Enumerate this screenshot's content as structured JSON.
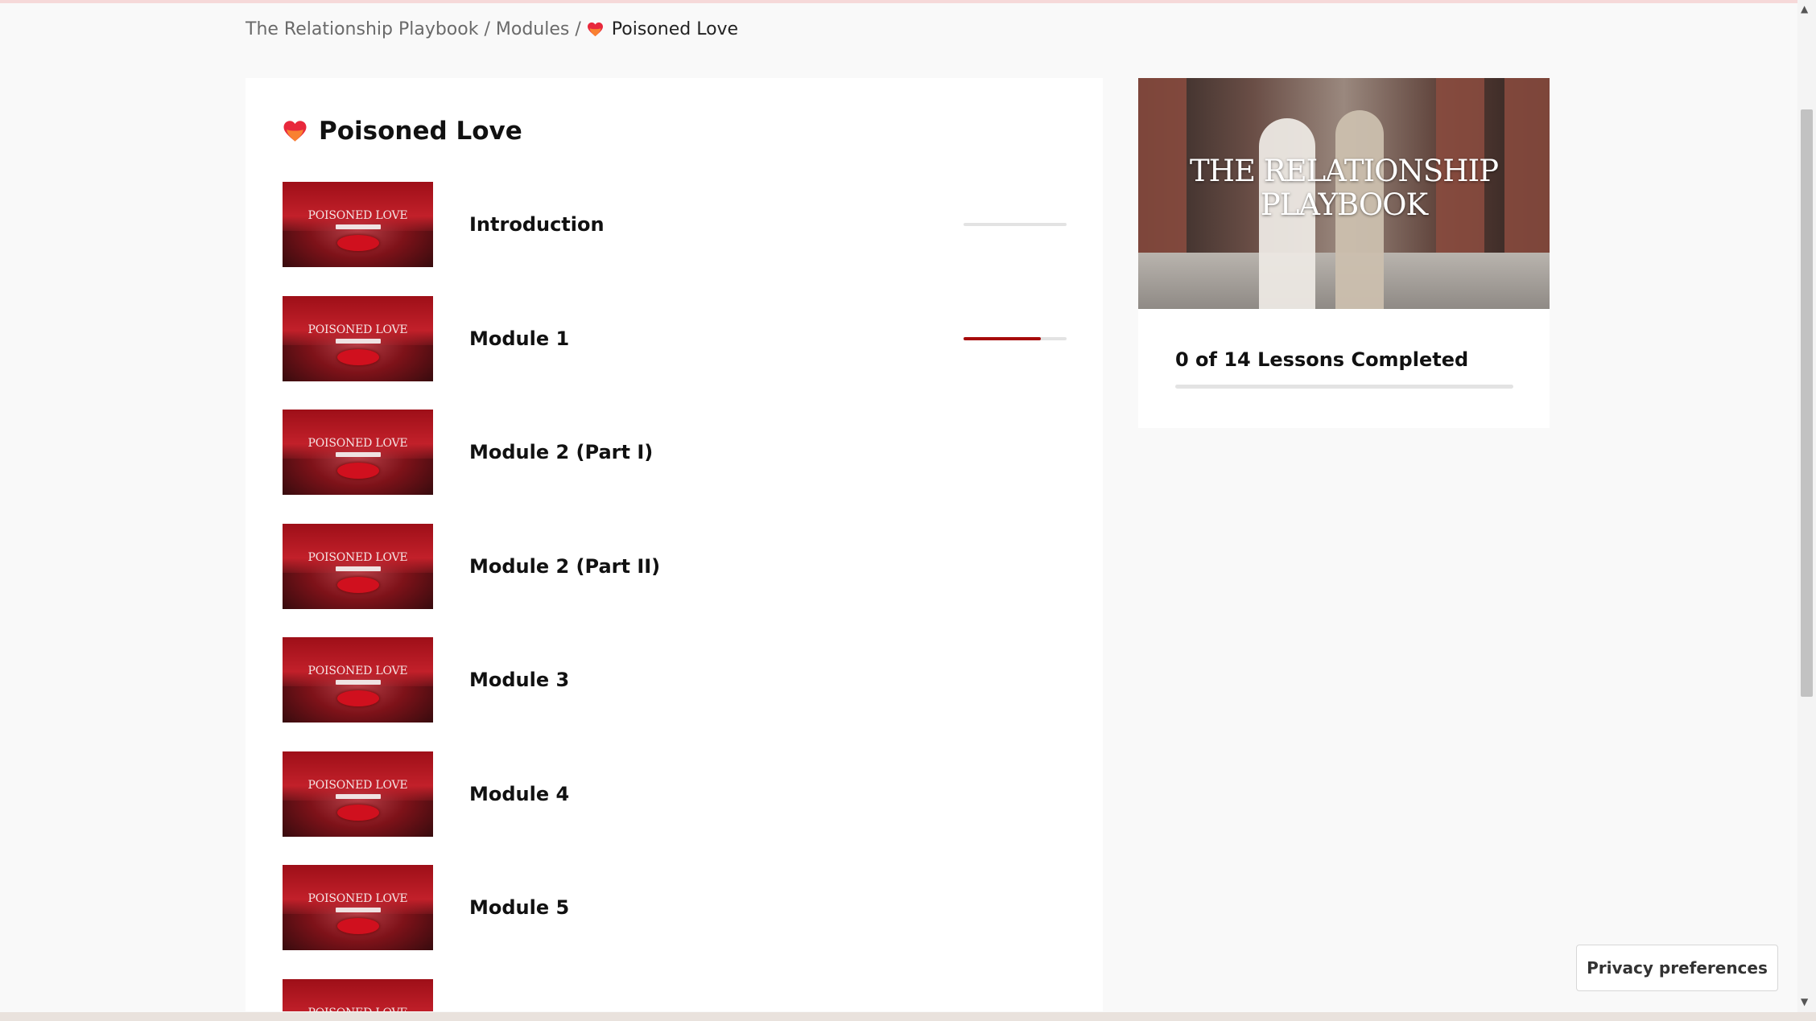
{
  "breadcrumb": {
    "root": "The Relationship Playbook",
    "modules": "Modules",
    "separator": "/",
    "current": "Poisoned Love"
  },
  "course": {
    "title": "Poisoned Love",
    "icon": "heart-icon",
    "accent_color": "#a60a0a",
    "thumbnail_text": "POISONED LOVE",
    "lessons": [
      {
        "title": "Introduction",
        "progress": 0
      },
      {
        "title": "Module 1",
        "progress": 0.75
      },
      {
        "title": "Module 2 (Part I)"
      },
      {
        "title": "Module 2 (Part II)"
      },
      {
        "title": "Module 3"
      },
      {
        "title": "Module 4"
      },
      {
        "title": "Module 5"
      },
      {
        "title": ""
      }
    ]
  },
  "sidebar": {
    "hero_text": "THE RELATIONSHIP PLAYBOOK",
    "lessons_completed": "0 of 14 Lessons Completed",
    "completed_fraction": 0
  },
  "privacy": {
    "label": "Privacy preferences"
  }
}
